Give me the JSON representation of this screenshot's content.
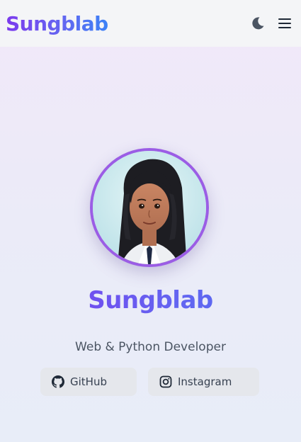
{
  "header": {
    "brand": "Sungblab",
    "theme_toggle_icon": "moon-icon",
    "menu_icon": "hamburger-menu-icon"
  },
  "hero": {
    "avatar_icon": "avatar",
    "name": "Sungblab",
    "tagline": "Web & Python Developer",
    "links": [
      {
        "label": "GitHub",
        "icon": "github-icon"
      },
      {
        "label": "Instagram",
        "icon": "instagram-icon"
      }
    ]
  },
  "colors": {
    "accent_purple": "#7c3aed",
    "accent_blue": "#3b82f6",
    "avatar_ring": "#9b5de5",
    "button_bg": "#e5e7ec"
  }
}
